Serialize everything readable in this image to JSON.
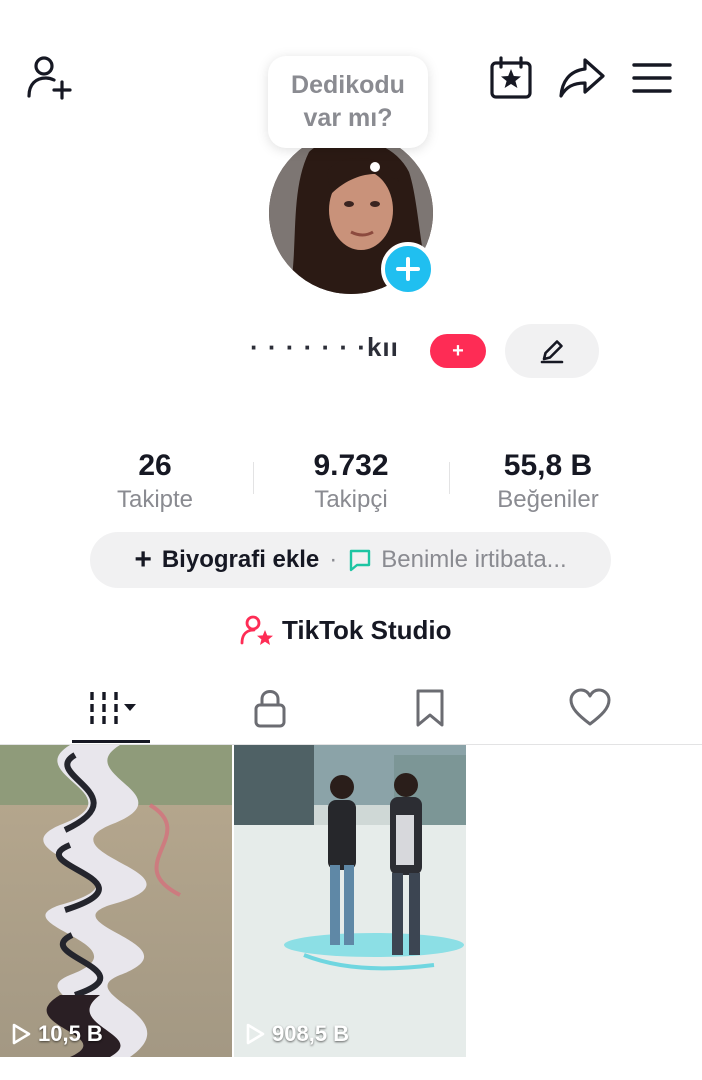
{
  "header": {
    "bubble_text": "Dedikodu var mı?",
    "icons": [
      "add-user-icon",
      "calendar-star-icon",
      "share-icon",
      "menu-icon"
    ]
  },
  "profile": {
    "name_partial": "·  ·  ·  ·  ·  · ·kıı",
    "badge": "+",
    "avatar_plus_color": "#20bff0"
  },
  "stats": {
    "following": {
      "value": "26",
      "label": "Takipte"
    },
    "followers": {
      "value": "9.732",
      "label": "Takipçi"
    },
    "likes": {
      "value": "55,8 B",
      "label": "Beğeniler"
    }
  },
  "bio": {
    "add_label": "Biyografi ekle",
    "separator": "·",
    "contact_label": "Benimle irtibata..."
  },
  "studio": {
    "label": "TikTok Studio"
  },
  "tabs": [
    "videos-tab",
    "private-tab",
    "saved-tab",
    "liked-tab"
  ],
  "videos": [
    {
      "views": "10,5 B"
    },
    {
      "views": "908,5 B"
    }
  ],
  "colors": {
    "accent_red": "#fe2c55",
    "accent_blue": "#20bff0",
    "text_primary": "#161823",
    "text_secondary": "#8a8b91",
    "pill_bg": "#f1f1f2",
    "chat_green": "#1dc5a3"
  }
}
